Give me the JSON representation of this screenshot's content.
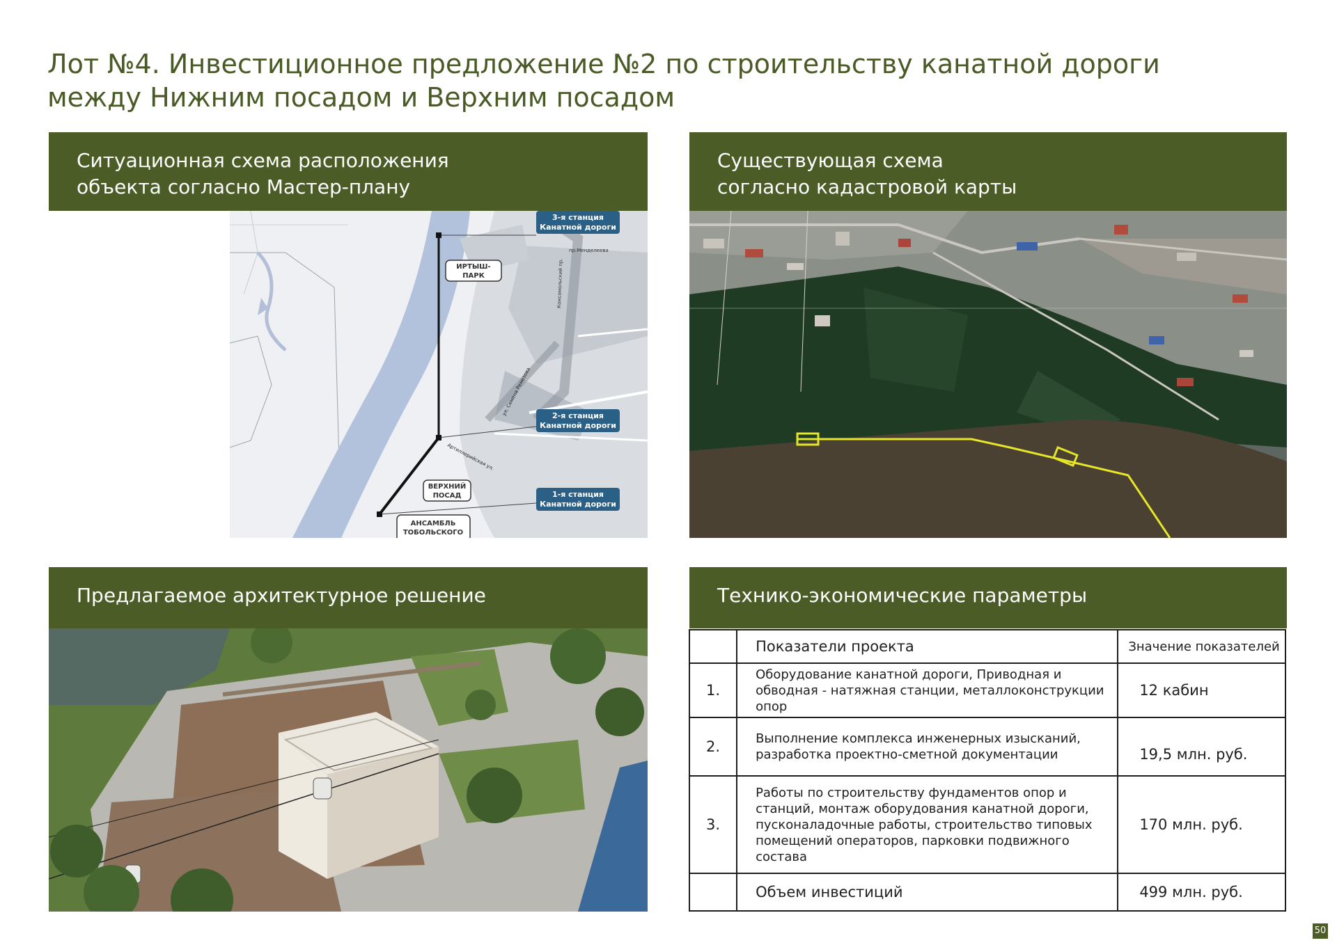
{
  "title": {
    "line1": "Лот №4. Инвестиционное предложение №2 по строительству канатной дороги",
    "line2": "между Нижним посадом и Верхним посадом"
  },
  "panels": {
    "situation": {
      "line1": "Ситуационная схема расположения",
      "line2": "объекта согласно Мастер-плану"
    },
    "cadastral": {
      "line1": "Существующая схема",
      "line2": "согласно кадастровой карты"
    },
    "architecture": {
      "line1": "Предлагаемое архитектурное решение"
    },
    "params": {
      "line1": "Технико-экономические параметры"
    }
  },
  "map": {
    "station3": [
      "3-я станция",
      "Канатной дороги"
    ],
    "station2": [
      "2-я станция",
      "Канатной дороги"
    ],
    "station1": [
      "1-я станция",
      "Канатной дороги"
    ],
    "irtysh_park": [
      "ИРТЫШ-",
      "ПАРК"
    ],
    "upper_posad": [
      "ВЕРХНИЙ",
      "ПОСАД"
    ],
    "ensemble": [
      "АНСАМБЛЬ",
      "ТОБОЛЬСКОГО"
    ],
    "street_mendeleeva": "пр.Менделеева",
    "street_komsomolsky": "Комсомольский пр.",
    "street_semena": "ул. Семена Ремезова",
    "street_artem": "Артиллерийская ул."
  },
  "table": {
    "header_name": "Показатели проекта",
    "header_value": "Значение показателей",
    "rows": [
      {
        "num": "1.",
        "name": "Оборудование канатной дороги, Приводная и обводная - натяжная станции, металлоконструкции опор",
        "value": "12 кабин"
      },
      {
        "num": "2.",
        "name": "Выполнение комплекса инженерных изысканий, разработка проектно-сметной документации",
        "value": "19,5 млн. руб."
      },
      {
        "num": "3.",
        "name": "Работы по строительству фундаментов опор и станций, монтаж оборудования канатной дороги, пусконаладочные работы, строительство типовых помещений операторов, парковки подвижного состава",
        "value": "170 млн. руб."
      }
    ],
    "total_name": "Объем инвестиций",
    "total_value": "499 млн. руб."
  },
  "page_number": "50",
  "colors": {
    "accent": "#4b5c26",
    "station_badge": "#2a5f86",
    "route": "#e5e52a"
  }
}
